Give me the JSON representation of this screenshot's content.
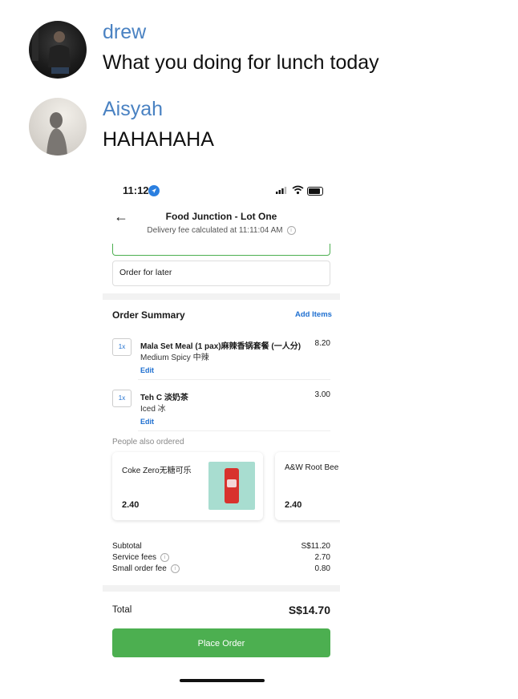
{
  "chat": {
    "messages": [
      {
        "sender": "drew",
        "text": "What you doing for lunch today"
      },
      {
        "sender": "Aisyah",
        "text": "HAHAHAHA"
      }
    ]
  },
  "shot": {
    "status_time": "11:12",
    "title": "Food Junction - Lot One",
    "subtitle": "Delivery fee calculated at 11:11:04 AM",
    "order_later": "Order for later",
    "order_summary_title": "Order Summary",
    "add_items": "Add Items",
    "items": [
      {
        "qty": "1x",
        "name": "Mala Set Meal (1 pax)麻辣香锅套餐 (一人分)",
        "option": "Medium Spicy 中辣",
        "edit": "Edit",
        "price": "8.20"
      },
      {
        "qty": "1x",
        "name": "Teh C 淡奶茶",
        "option": "Iced 冰",
        "edit": "Edit",
        "price": "3.00"
      }
    ],
    "people_also_ordered": "People also ordered",
    "suggestions": [
      {
        "name": "Coke Zero无糖可乐",
        "price": "2.40"
      },
      {
        "name": "A&W Root Bee",
        "price": "2.40"
      }
    ],
    "summary": [
      {
        "label": "Subtotal",
        "value": "S$11.20"
      },
      {
        "label": "Service fees",
        "value": "2.70"
      },
      {
        "label": "Small order fee",
        "value": "0.80"
      }
    ],
    "info_glyph": "i",
    "total_label": "Total",
    "total_value": "S$14.70",
    "place_order": "Place Order"
  },
  "icons": {
    "back": "←"
  },
  "colors": {
    "sender_name": "#4a82c2",
    "accent_green": "#4caf50",
    "link_blue": "#1e6fd0"
  }
}
